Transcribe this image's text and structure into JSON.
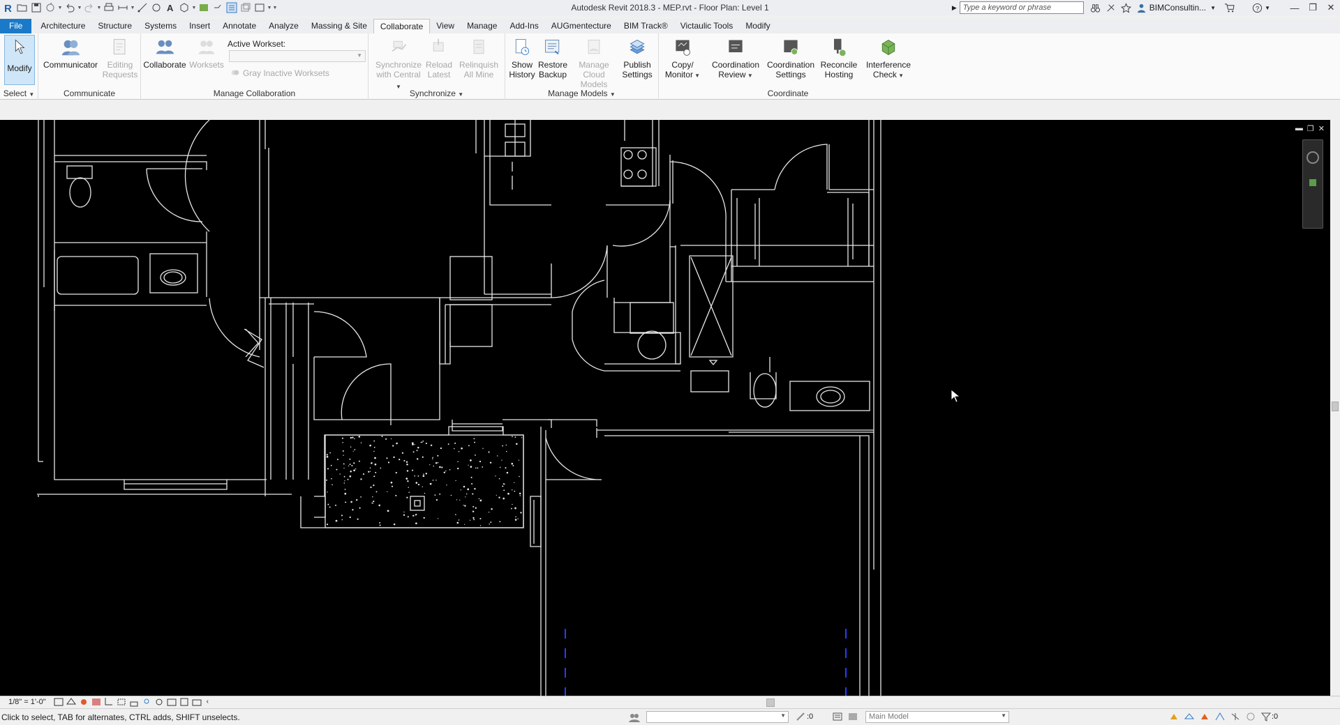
{
  "app": {
    "title": "Autodesk Revit 2018.3 -     MEP.rvt - Floor Plan: Level 1",
    "search_placeholder": "Type a keyword or phrase",
    "user": "BIMConsultin...",
    "accent": "#1a7ac9"
  },
  "tabs": [
    {
      "label": "File",
      "kind": "file"
    },
    {
      "label": "Architecture"
    },
    {
      "label": "Structure"
    },
    {
      "label": "Systems"
    },
    {
      "label": "Insert"
    },
    {
      "label": "Annotate"
    },
    {
      "label": "Analyze"
    },
    {
      "label": "Massing & Site"
    },
    {
      "label": "Collaborate",
      "active": true
    },
    {
      "label": "View"
    },
    {
      "label": "Manage"
    },
    {
      "label": "Add-Ins"
    },
    {
      "label": "AUGmentecture"
    },
    {
      "label": "BIM Track®"
    },
    {
      "label": "Victaulic Tools"
    },
    {
      "label": "Modify"
    }
  ],
  "ribbon": {
    "select": {
      "modify": "Modify",
      "title": "Select"
    },
    "communicate": {
      "communicator": "Communicator",
      "editing_requests_1": "Editing",
      "editing_requests_2": "Requests",
      "title": "Communicate"
    },
    "manage_collab": {
      "collaborate": "Collaborate",
      "worksets": "Worksets",
      "active_workset": "Active Workset:",
      "gray_inactive": "Gray Inactive Worksets",
      "title": "Manage Collaboration"
    },
    "synchronize": {
      "sync_1": "Synchronize",
      "sync_2": "with Central",
      "reload_1": "Reload",
      "reload_2": "Latest",
      "relinquish_1": "Relinquish",
      "relinquish_2": "All Mine",
      "title": "Synchronize"
    },
    "manage_models": {
      "show_1": "Show",
      "show_2": "History",
      "restore_1": "Restore",
      "restore_2": "Backup",
      "cloud_1": "Manage",
      "cloud_2": "Cloud Models",
      "publish_1": "Publish",
      "publish_2": "Settings",
      "title": "Manage Models"
    },
    "coordinate": {
      "copy_1": "Copy/",
      "copy_2": "Monitor",
      "review_1": "Coordination",
      "review_2": "Review",
      "settings_1": "Coordination",
      "settings_2": "Settings",
      "reconcile_1": "Reconcile",
      "reconcile_2": "Hosting",
      "interference_1": "Interference",
      "interference_2": "Check",
      "title": "Coordinate"
    }
  },
  "viewbar": {
    "scale": "1/8\" = 1'-0\""
  },
  "statusbar": {
    "text": "Click to select, TAB for alternates, CTRL adds, SHIFT unselects.",
    "workset_value": ":0",
    "design_option": "Main Model",
    "filter_count": ":0"
  },
  "icons": [
    "revit-logo-icon",
    "open-icon",
    "save-icon",
    "sync-icon",
    "undo-icon",
    "redo-icon",
    "print-icon",
    "measure-icon",
    "dimension-icon",
    "tag-icon",
    "text-icon",
    "3d-view-icon",
    "section-icon",
    "thin-lines-icon",
    "close-windows-icon",
    "switch-windows-icon",
    "binoculars-icon",
    "star-icon",
    "user-icon",
    "cart-icon",
    "help-icon"
  ]
}
